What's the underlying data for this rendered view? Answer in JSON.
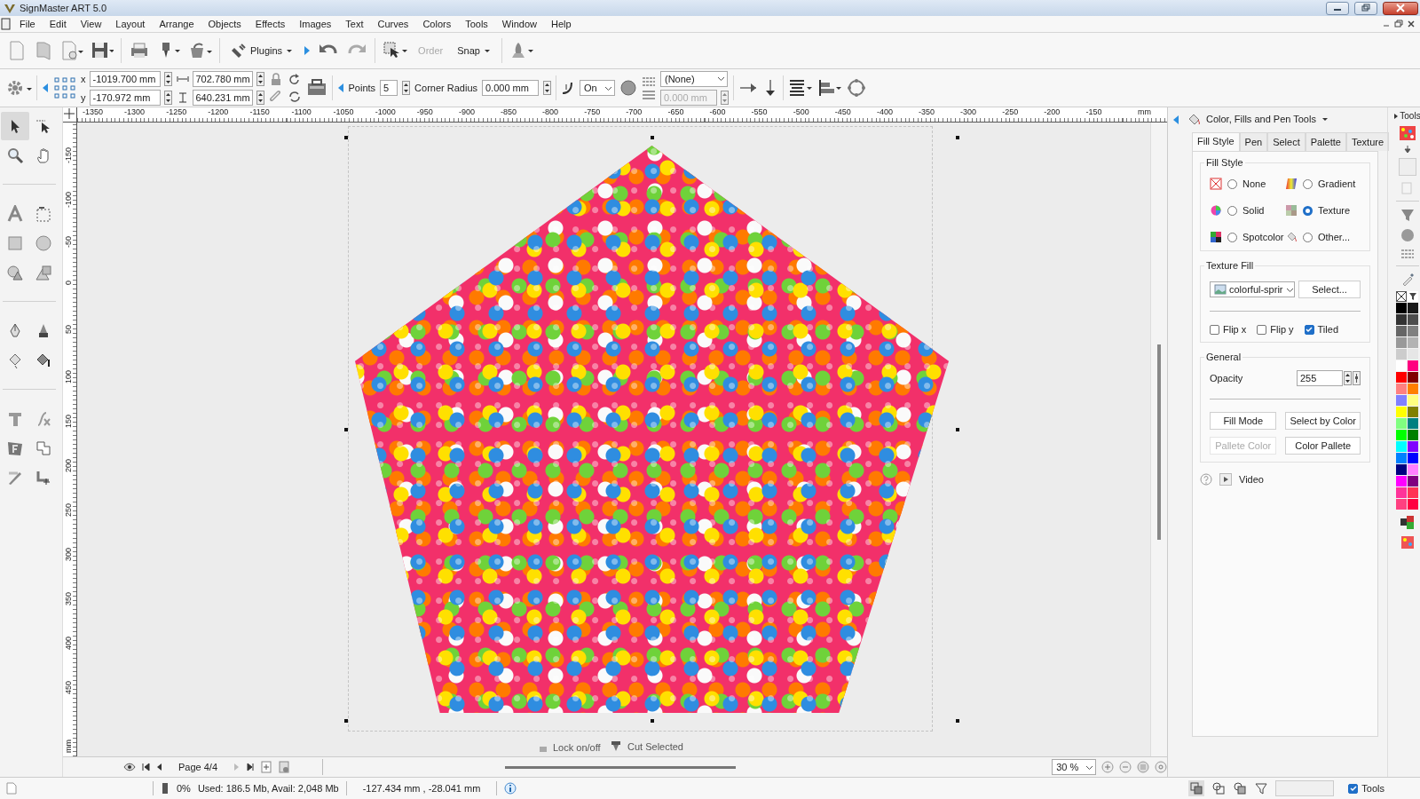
{
  "window": {
    "title": "SignMaster ART 5.0"
  },
  "menu": [
    "File",
    "Edit",
    "View",
    "Layout",
    "Arrange",
    "Objects",
    "Effects",
    "Images",
    "Text",
    "Curves",
    "Colors",
    "Tools",
    "Window",
    "Help"
  ],
  "toolbar": {
    "plugins": "Plugins",
    "order": {
      "label": "Order",
      "disabled": true
    },
    "snap": "Snap"
  },
  "properties_bar": {
    "x_label": "x",
    "x": "-1019.700 mm",
    "y_label": "y",
    "y": "-170.972 mm",
    "width": "702.780 mm",
    "height": "640.231 mm",
    "points_label": "Points",
    "points": "5",
    "corner_radius_label": "Corner Radius",
    "corner_radius": "0.000 mm",
    "mode": "On",
    "pen": "(None)",
    "pen_width": {
      "value": "0.000 mm",
      "disabled": true
    }
  },
  "rulers": {
    "horizontal": [
      "-1350",
      "-1300",
      "-1250",
      "-1200",
      "-1150",
      "-1100",
      "-1050",
      "-1000",
      "-950",
      "-900",
      "-850",
      "-800",
      "-750",
      "-700",
      "-650",
      "-600",
      "-550",
      "-500",
      "-450",
      "-400",
      "-350",
      "-300",
      "-250",
      "-200",
      "-150"
    ],
    "horizontal_unit": "mm",
    "vertical": [
      "-150",
      "-100",
      "-50",
      "0",
      "50",
      "100",
      "150",
      "200",
      "250",
      "300",
      "350",
      "400",
      "450"
    ],
    "vertical_unit": "mm"
  },
  "canvas": {
    "lock": "Lock on/off",
    "cut": "Cut Selected"
  },
  "page_nav": {
    "page": "Page 4/4",
    "zoom": "30 %"
  },
  "panel": {
    "title": "Color, Fills and Pen Tools",
    "tabs": [
      {
        "label": "Fill Style",
        "selected": true
      },
      {
        "label": "Pen",
        "selected": false
      },
      {
        "label": "Select",
        "selected": false
      },
      {
        "label": "Palette",
        "selected": false
      },
      {
        "label": "Texture",
        "selected": false
      }
    ],
    "fill_style": {
      "title": "Fill Style",
      "options": [
        {
          "label": "None",
          "selected": false
        },
        {
          "label": "Gradient",
          "selected": false
        },
        {
          "label": "Solid",
          "selected": false
        },
        {
          "label": "Texture",
          "selected": true
        },
        {
          "label": "Spotcolor",
          "selected": false
        },
        {
          "label": "Other...",
          "selected": false
        }
      ]
    },
    "texture_fill": {
      "title": "Texture Fill",
      "texture": "colorful-sprir",
      "select": "Select...",
      "checks": [
        {
          "label": "Flip x",
          "checked": false
        },
        {
          "label": "Flip y",
          "checked": false
        },
        {
          "label": "Tiled",
          "checked": true
        }
      ]
    },
    "general": {
      "title": "General",
      "opacity_label": "Opacity",
      "opacity": "255"
    },
    "buttons": [
      {
        "label": "Fill Mode",
        "disabled": false
      },
      {
        "label": "Select by Color",
        "disabled": false
      },
      {
        "label": "Pallete Color",
        "disabled": true
      },
      {
        "label": "Color Pallete",
        "disabled": false
      }
    ],
    "video": "Video"
  },
  "side_tools": "Tools",
  "palette": [
    {
      "color": "#000000"
    },
    {
      "color": "#1a1a1a"
    },
    {
      "color": "#333333"
    },
    {
      "color": "#4d4d4d"
    },
    {
      "color": "#666666"
    },
    {
      "color": "#808080"
    },
    {
      "color": "#999999"
    },
    {
      "color": "#b3b3b3"
    },
    {
      "color": "#cccccc"
    },
    {
      "color": "#e6e6e6"
    },
    {
      "color": "#ffffff"
    },
    {
      "color": "#ff0080"
    },
    {
      "color": "#ff0000"
    },
    {
      "color": "#800000"
    },
    {
      "color": "#ff8080"
    },
    {
      "color": "#ff8000"
    },
    {
      "color": "#8080ff"
    },
    {
      "color": "#ffff80"
    },
    {
      "color": "#ffff00"
    },
    {
      "color": "#808000"
    },
    {
      "color": "#80ff80"
    },
    {
      "color": "#008080"
    },
    {
      "color": "#00ff00"
    },
    {
      "color": "#008000"
    },
    {
      "color": "#00ffff"
    },
    {
      "color": "#8000ff"
    },
    {
      "color": "#0080ff"
    },
    {
      "color": "#0000ff"
    },
    {
      "color": "#000080"
    },
    {
      "color": "#ff80ff"
    },
    {
      "color": "#ff00ff"
    },
    {
      "color": "#800080"
    },
    {
      "color": "#ff3399"
    },
    {
      "color": "#ff3355"
    },
    {
      "color": "#ff4080"
    },
    {
      "color": "#ff0040"
    }
  ],
  "status": {
    "memory_percent": "0%",
    "memory": "Used: 186.5 Mb, Avail: 2,048 Mb",
    "coords": "-127.434 mm , -28.041 mm",
    "tools": {
      "label": "Tools",
      "checked": true
    }
  }
}
